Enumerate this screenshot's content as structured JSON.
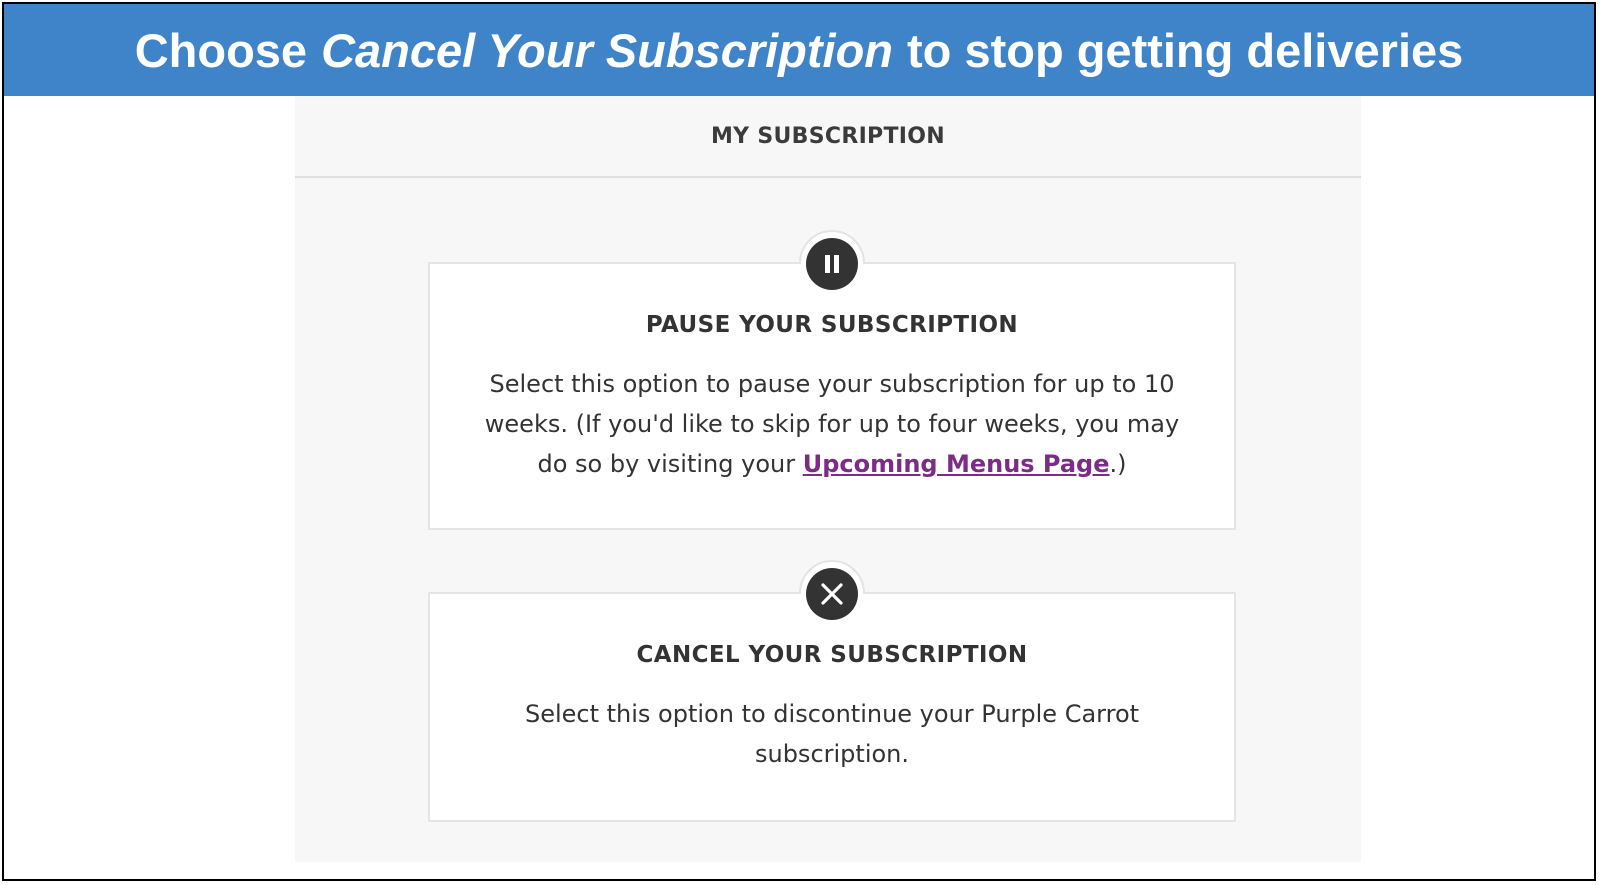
{
  "banner": {
    "prefix": "Choose",
    "emphasis": "Cancel Your Subscription",
    "suffix": "to stop getting deliveries"
  },
  "panel": {
    "title": "MY SUBSCRIPTION"
  },
  "options": {
    "pause": {
      "icon": "pause-icon",
      "title": "PAUSE YOUR SUBSCRIPTION",
      "desc_before": "Select this option to pause your subscription for up to 10 weeks. (If you'd like to skip for up to four weeks, you may do so by visiting your ",
      "link_text": "Upcoming Menus Page",
      "desc_after": ".)"
    },
    "cancel": {
      "icon": "close-icon",
      "title": "CANCEL YOUR SUBSCRIPTION",
      "desc": "Select this option to discontinue your Purple Carrot subscription."
    }
  },
  "colors": {
    "banner": "#3f84c8",
    "panel_bg": "#f7f7f7",
    "link": "#7b2d86",
    "icon_bg": "#333333"
  }
}
